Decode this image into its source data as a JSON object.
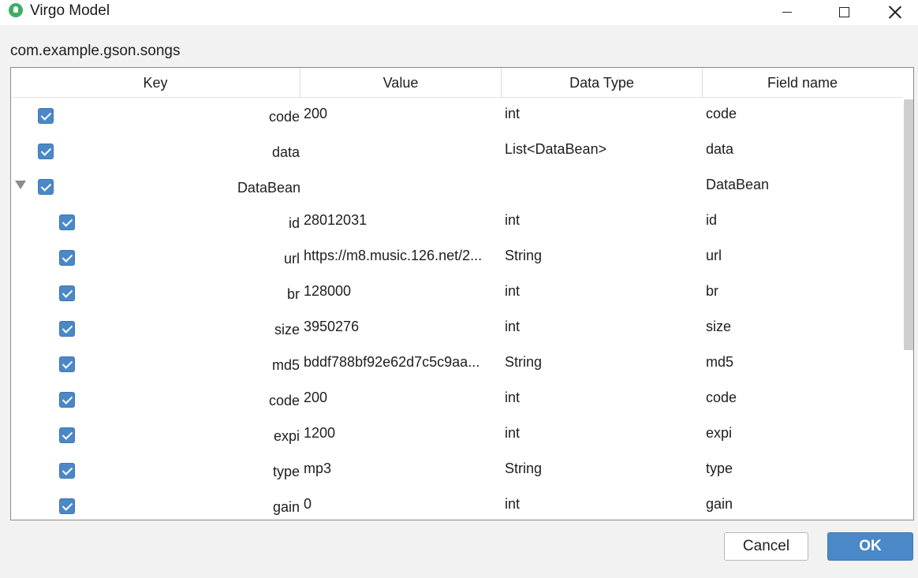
{
  "window": {
    "title": "Virgo Model",
    "icon": "android-head-icon",
    "controls": [
      "minimize",
      "maximize",
      "close"
    ]
  },
  "class_path": "com.example.gson.songs",
  "table": {
    "columns": [
      "Key",
      "Value",
      "Data Type",
      "Field name"
    ],
    "rows": [
      {
        "key": "code",
        "value": "200",
        "type": "int",
        "field": "code",
        "checked": true,
        "level": 0,
        "expandable": false
      },
      {
        "key": "data",
        "value": "",
        "type": "List<DataBean>",
        "field": "data",
        "checked": true,
        "level": 0,
        "expandable": false
      },
      {
        "key": "DataBean",
        "value": "",
        "type": "",
        "field": "DataBean",
        "checked": true,
        "level": 0,
        "expandable": true,
        "expanded": true
      },
      {
        "key": "id",
        "value": "28012031",
        "type": "int",
        "field": "id",
        "checked": true,
        "level": 1,
        "expandable": false
      },
      {
        "key": "url",
        "value": "https://m8.music.126.net/2...",
        "type": "String",
        "field": "url",
        "checked": true,
        "level": 1,
        "expandable": false
      },
      {
        "key": "br",
        "value": "128000",
        "type": "int",
        "field": "br",
        "checked": true,
        "level": 1,
        "expandable": false
      },
      {
        "key": "size",
        "value": "3950276",
        "type": "int",
        "field": "size",
        "checked": true,
        "level": 1,
        "expandable": false
      },
      {
        "key": "md5",
        "value": "bddf788bf92e62d7c5c9aa...",
        "type": "String",
        "field": "md5",
        "checked": true,
        "level": 1,
        "expandable": false
      },
      {
        "key": "code",
        "value": "200",
        "type": "int",
        "field": "code",
        "checked": true,
        "level": 1,
        "expandable": false
      },
      {
        "key": "expi",
        "value": "1200",
        "type": "int",
        "field": "expi",
        "checked": true,
        "level": 1,
        "expandable": false
      },
      {
        "key": "type",
        "value": "mp3",
        "type": "String",
        "field": "type",
        "checked": true,
        "level": 1,
        "expandable": false
      },
      {
        "key": "gain",
        "value": "0",
        "type": "int",
        "field": "gain",
        "checked": true,
        "level": 1,
        "expandable": false
      }
    ]
  },
  "buttons": {
    "cancel": "Cancel",
    "ok": "OK"
  },
  "colors": {
    "accent": "#4a88c7",
    "background": "#f2f2f2",
    "table_background": "#ffffff"
  }
}
